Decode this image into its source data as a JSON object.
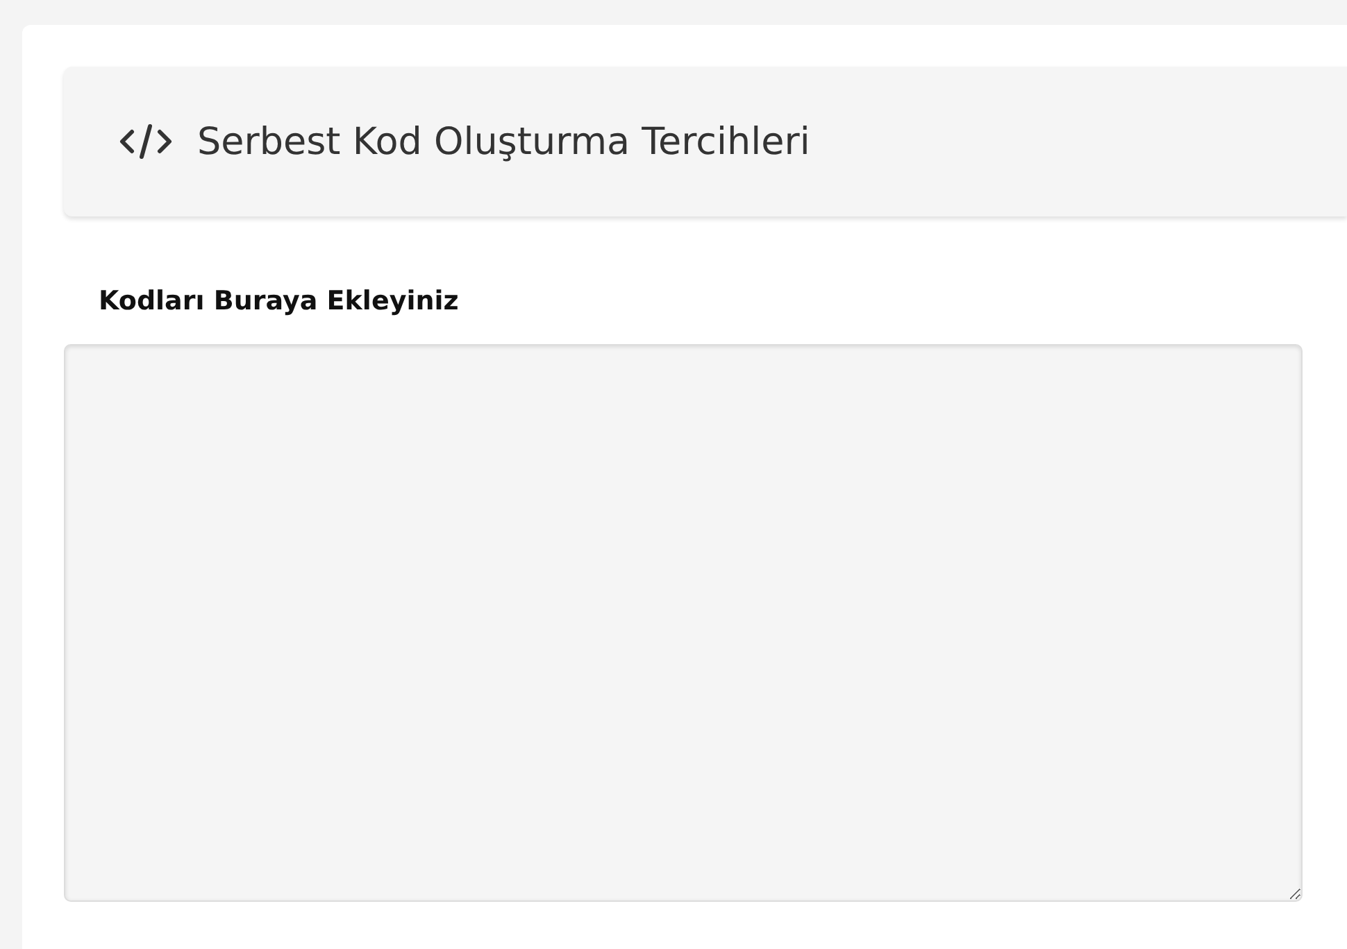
{
  "header": {
    "title": "Serbest Kod Oluşturma Tercihleri"
  },
  "code_field": {
    "label": "Kodları Buraya Ekleyiniz"
  }
}
